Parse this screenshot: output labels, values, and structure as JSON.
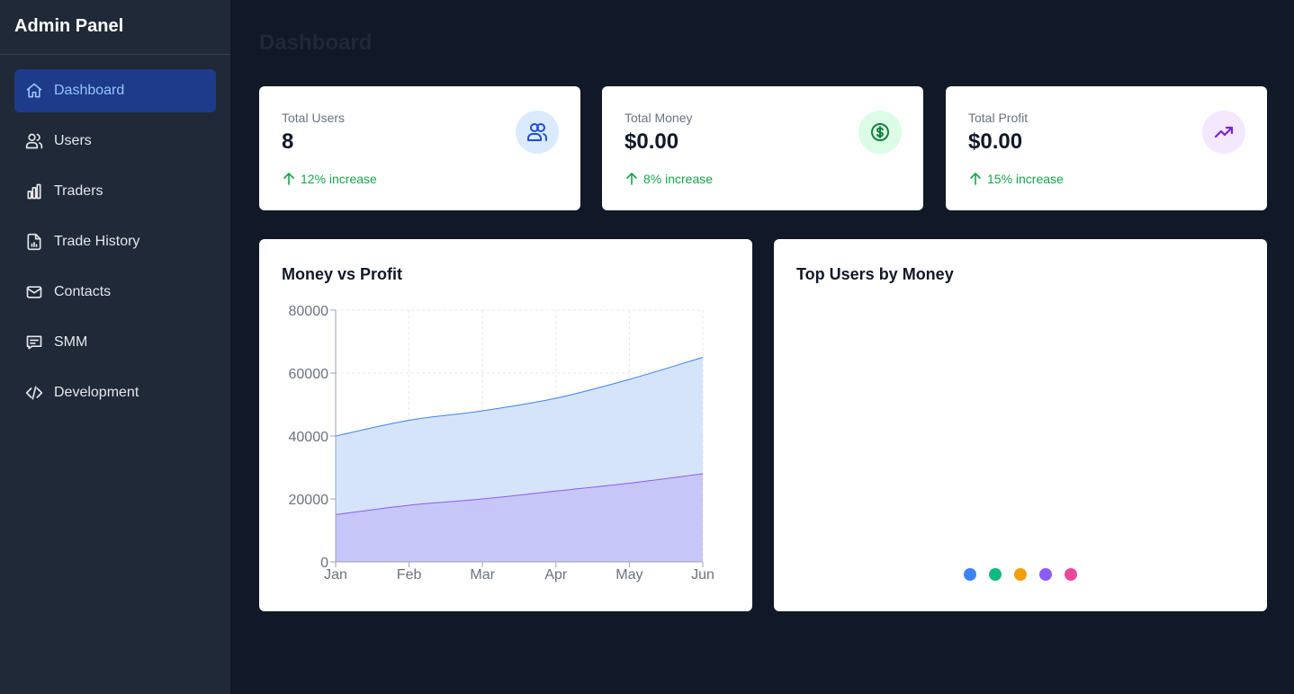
{
  "sidebar": {
    "title": "Admin Panel",
    "items": [
      {
        "label": "Dashboard",
        "icon": "home-icon",
        "active": true
      },
      {
        "label": "Users",
        "icon": "users-icon"
      },
      {
        "label": "Traders",
        "icon": "bar-chart-icon"
      },
      {
        "label": "Trade History",
        "icon": "file-chart-icon"
      },
      {
        "label": "Contacts",
        "icon": "mail-icon"
      },
      {
        "label": "SMM",
        "icon": "message-icon"
      },
      {
        "label": "Development",
        "icon": "code-icon"
      }
    ]
  },
  "main": {
    "title": "Dashboard",
    "stats": [
      {
        "label": "Total Users",
        "value": "8",
        "trend": "12% increase",
        "icon": "users-icon",
        "icon_bg": "#dbeafe",
        "icon_color": "#1d4ed8"
      },
      {
        "label": "Total Money",
        "value": "$0.00",
        "trend": "8% increase",
        "icon": "dollar-circle-icon",
        "icon_bg": "#dcfce7",
        "icon_color": "#15803d"
      },
      {
        "label": "Total Profit",
        "value": "$0.00",
        "trend": "15% increase",
        "icon": "trending-up-icon",
        "icon_bg": "#f3e8ff",
        "icon_color": "#7e22ce"
      }
    ],
    "money_chart_title": "Money vs Profit",
    "top_users_title": "Top Users by Money"
  },
  "colors": {
    "trend_green": "#16a34a",
    "money_line": "#3b82f6",
    "money_fill": "#d6e4fb",
    "profit_line": "#8b5cf6",
    "profit_fill": "#c7c6f8"
  },
  "chart_data": [
    {
      "type": "area",
      "title": "Money vs Profit",
      "x": [
        "Jan",
        "Feb",
        "Mar",
        "Apr",
        "May",
        "Jun"
      ],
      "ylim": [
        0,
        80000
      ],
      "yticks": [
        "0",
        "20000",
        "40000",
        "60000",
        "80000"
      ],
      "grid": true,
      "series": [
        {
          "values": [
            40000,
            45000,
            48000,
            52000,
            58000,
            65000
          ],
          "color": "#3b82f6"
        },
        {
          "values": [
            15000,
            18000,
            20000,
            22500,
            25000,
            28000
          ],
          "color": "#8b5cf6"
        }
      ]
    },
    {
      "type": "pie",
      "title": "Top Users by Money",
      "legend_colors": [
        "#3b82f6",
        "#10b981",
        "#f59e0b",
        "#8b5cf6",
        "#ec4899"
      ],
      "legend": "bottom"
    }
  ]
}
